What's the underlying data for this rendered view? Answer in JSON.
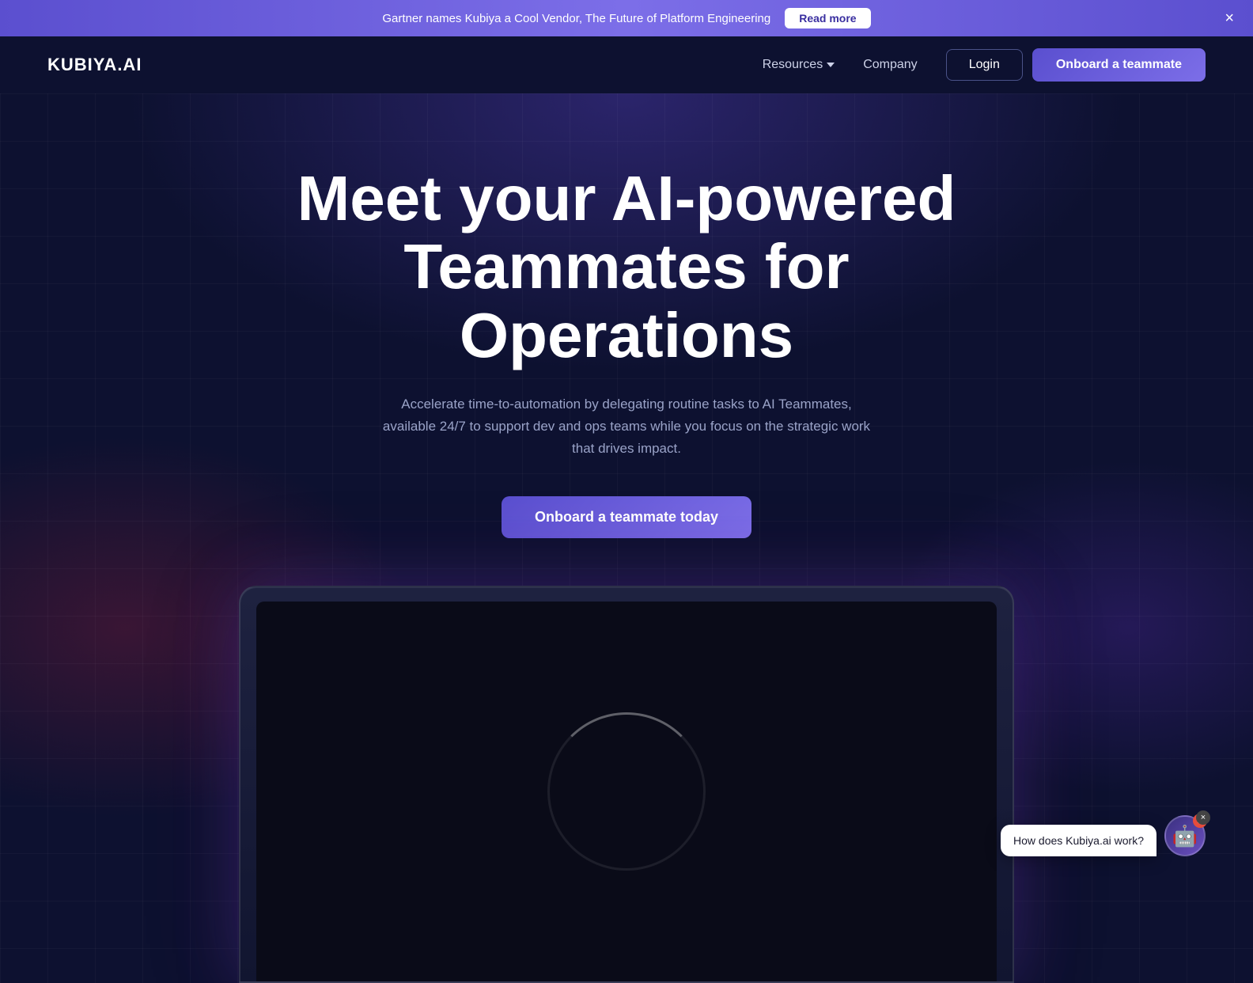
{
  "banner": {
    "text": "Gartner names Kubiya a Cool Vendor, The Future of Platform Engineering",
    "read_more_label": "Read more",
    "close_icon": "×"
  },
  "navbar": {
    "logo": "KUBIYA.AI",
    "resources_label": "Resources",
    "company_label": "Company",
    "login_label": "Login",
    "cta_label": "Onboard a teammate"
  },
  "hero": {
    "title_line1": "Meet your AI-powered",
    "title_line2": "Teammates for Operations",
    "subtitle": "Accelerate time-to-automation by delegating routine tasks to AI Teammates, available 24/7 to support dev and ops teams while you focus on the strategic work that drives impact.",
    "cta_label": "Onboard a teammate today"
  },
  "chat_widget": {
    "bubble_text": "How does Kubiya.ai work?",
    "badge_count": "1",
    "avatar_icon": "🤖",
    "close_icon": "×"
  }
}
